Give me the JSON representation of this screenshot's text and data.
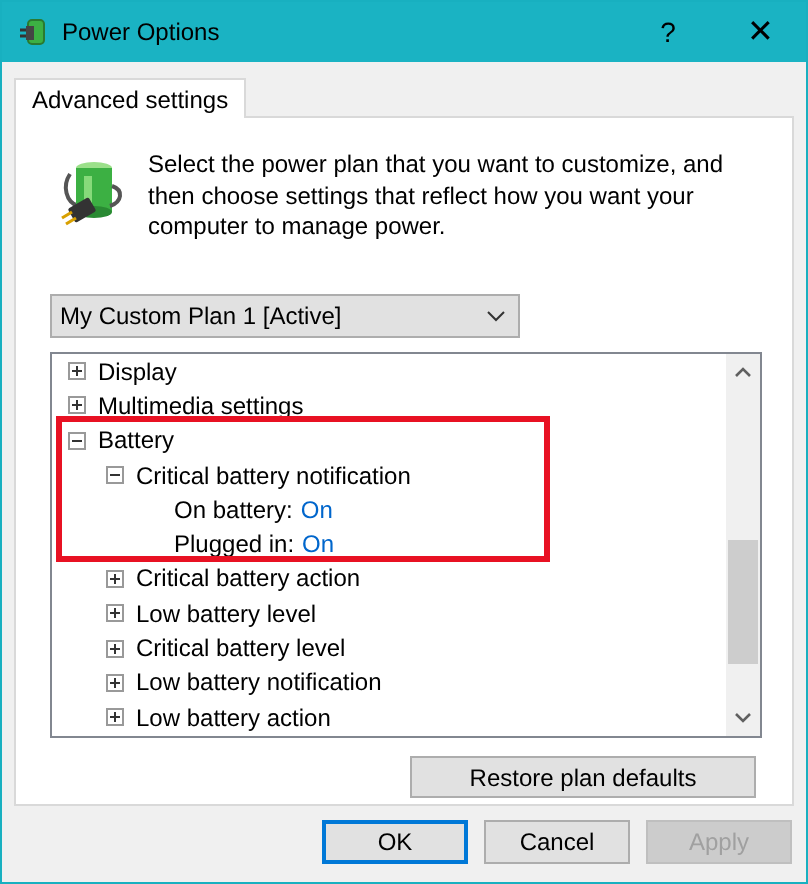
{
  "window": {
    "title": "Power Options",
    "help": "?",
    "close": "✕"
  },
  "tabs": [
    {
      "label": "Advanced settings",
      "selected": true
    }
  ],
  "description": "Select the power plan that you want to customize, and then choose settings that reflect how you want your computer to manage power.",
  "plan_dropdown": {
    "value": "My Custom Plan 1 [Active]"
  },
  "tree": [
    {
      "kind": "group",
      "label": "Display",
      "expanded": false,
      "highlighted": false
    },
    {
      "kind": "group",
      "label": "Multimedia settings",
      "expanded": false,
      "highlighted": false
    },
    {
      "kind": "group",
      "label": "Battery",
      "expanded": true,
      "highlighted": true,
      "children": [
        {
          "kind": "group",
          "label": "Critical battery notification",
          "expanded": true,
          "highlighted": true,
          "children": [
            {
              "kind": "setting",
              "label": "On battery:",
              "value": "On",
              "highlighted": true
            },
            {
              "kind": "setting",
              "label": "Plugged in:",
              "value": "On",
              "highlighted": true
            }
          ]
        },
        {
          "kind": "group",
          "label": "Critical battery action",
          "expanded": false,
          "highlighted": false
        },
        {
          "kind": "group",
          "label": "Low battery level",
          "expanded": false,
          "highlighted": false
        },
        {
          "kind": "group",
          "label": "Critical battery level",
          "expanded": false,
          "highlighted": false
        },
        {
          "kind": "group",
          "label": "Low battery notification",
          "expanded": false,
          "highlighted": false
        },
        {
          "kind": "group",
          "label": "Low battery action",
          "expanded": false,
          "highlighted": false
        }
      ]
    }
  ],
  "restore_button": "Restore plan defaults",
  "buttons": [
    {
      "label": "OK",
      "default": true,
      "disabled": false
    },
    {
      "label": "Cancel",
      "default": false,
      "disabled": false
    },
    {
      "label": "Apply",
      "default": false,
      "disabled": true
    }
  ]
}
